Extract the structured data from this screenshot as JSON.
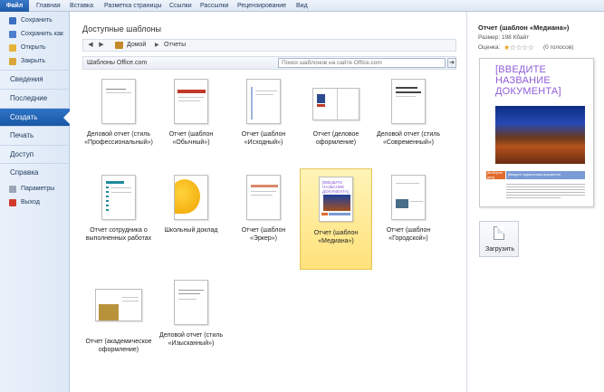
{
  "ribbon": {
    "file_tab": "Файл",
    "tabs": [
      "Главная",
      "Вставка",
      "Разметка страницы",
      "Ссылки",
      "Рассылки",
      "Рецензирование",
      "Вид"
    ]
  },
  "nav": {
    "save": "Сохранить",
    "save_as": "Сохранить как",
    "open": "Открыть",
    "close": "Закрыть",
    "info": "Сведения",
    "recent": "Последние",
    "new": "Создать",
    "print": "Печать",
    "share": "Доступ",
    "help": "Справка",
    "options": "Параметры",
    "exit": "Выход"
  },
  "main": {
    "title": "Доступные шаблоны",
    "breadcrumb": {
      "home": "Домой",
      "current": "Отчеты"
    },
    "section_label": "Шаблоны Office.com",
    "search_placeholder": "Поиск шаблонов на сайте Office.com",
    "templates": [
      {
        "line1": "Деловой отчет (стиль",
        "line2": "«Профессиональный»)"
      },
      {
        "line1": "Отчет (шаблон",
        "line2": "«Обычный»)"
      },
      {
        "line1": "Отчет (шаблон",
        "line2": "«Исходный»)"
      },
      {
        "line1": "Отчет (деловое",
        "line2": "оформление)"
      },
      {
        "line1": "Деловой отчет (стиль",
        "line2": "«Современный»)"
      },
      {
        "line1": "Отчет сотрудника о",
        "line2": "выполненных работах"
      },
      {
        "line1": "Школьный доклад",
        "line2": ""
      },
      {
        "line1": "Отчет (шаблон «Эркер»)",
        "line2": ""
      },
      {
        "line1": "Отчет (шаблон",
        "line2": "«Медиана»)"
      },
      {
        "line1": "Отчет (шаблон",
        "line2": "«Городской»)"
      },
      {
        "line1": "Отчет (академическое",
        "line2": "оформление)"
      },
      {
        "line1": "Деловой отчет (стиль",
        "line2": "«Изысканный»)"
      }
    ]
  },
  "preview": {
    "title": "Отчет (шаблон «Медиана»)",
    "size": "Размер: 198 Кбайт",
    "rating_label": "Оценка:",
    "rating_value": 1,
    "rating_max": 5,
    "votes": "(0 голосов)",
    "doc_heading": "[ВВЕДИТЕ НАЗВАНИЕ ДОКУМЕНТА]",
    "doc_year": "[Выберите дату]",
    "doc_subtitle": "[Введите подзаголовок документа]",
    "download_label": "Загрузить"
  }
}
